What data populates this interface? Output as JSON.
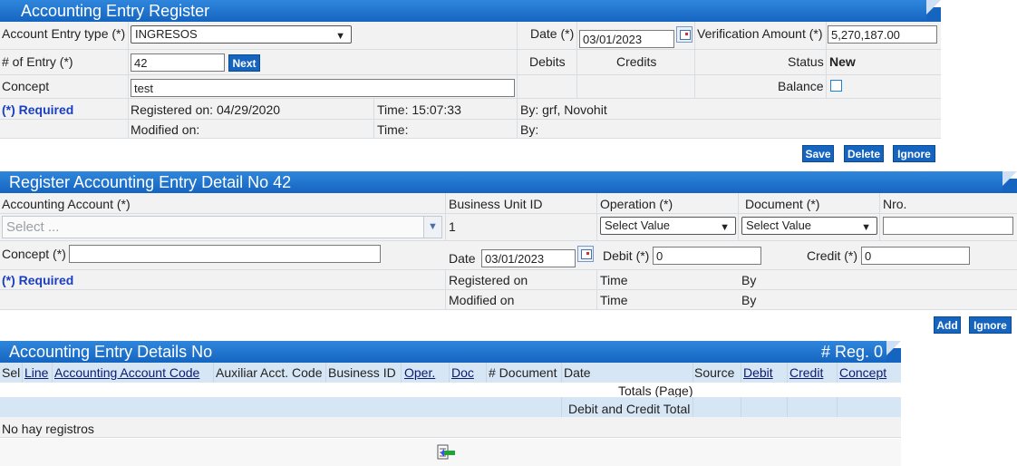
{
  "header": {
    "title": "Accounting Entry Register",
    "entry_type_label": "Account Entry type (*)",
    "entry_type_value": "INGRESOS",
    "date_label": "Date (*)",
    "date_value": "03/01/2023",
    "verification_label": "Verification Amount (*)",
    "verification_value": "5,270,187.00",
    "entry_no_label": "# of Entry (*)",
    "entry_no_value": "42",
    "next_label": "Next",
    "debits_label": "Debits",
    "credits_label": "Credits",
    "status_label": "Status",
    "status_value": "New",
    "concept_label": "Concept",
    "concept_value": "test",
    "balance_label": "Balance",
    "required_label": "(*) Required",
    "registered_on": "Registered on: 04/29/2020",
    "time_registered": "Time: 15:07:33",
    "by_registered": "By: grf, Novohit",
    "modified_on": "Modified on:",
    "time_modified": "Time:",
    "by_modified": "By:",
    "save_label": "Save",
    "delete_label": "Delete",
    "ignore_label": "Ignore"
  },
  "detail": {
    "title": "Register Accounting Entry Detail No 42",
    "account_label": "Accounting Account (*)",
    "account_placeholder": "Select ...",
    "business_unit_label": "Business Unit ID",
    "business_unit_value": "1",
    "operation_label": "Operation (*)",
    "operation_value": "Select Value",
    "document_label": "Document (*)",
    "document_value": "Select Value",
    "nro_label": "Nro.",
    "nro_value": "",
    "concept_label": "Concept (*)",
    "concept_value": "",
    "date_label": "Date",
    "date_value": "03/01/2023",
    "debit_label": "Debit (*)",
    "debit_value": "0",
    "credit_label": "Credit (*)",
    "credit_value": "0",
    "required_label": "(*) Required",
    "registered_on": "Registered on",
    "time_registered": "Time",
    "by_registered": "By",
    "modified_on": "Modified on",
    "time_modified": "Time",
    "by_modified": "By",
    "add_label": "Add",
    "ignore_label": "Ignore"
  },
  "list": {
    "title": "Accounting Entry Details No",
    "reg_count": "# Reg. 0",
    "columns": [
      "Sel",
      "Line",
      "Accounting Account Code",
      "Auxiliar Acct. Code",
      "Business ID",
      "Oper.",
      "Doc",
      "# Document",
      "Date",
      "Source",
      "Debit",
      "Credit",
      "Concept"
    ],
    "totals_page": "Totals (Page)",
    "debit_credit_total": "Debit and Credit Total",
    "empty_message": "No hay registros"
  },
  "colors": {
    "accent": "#1565c0",
    "required": "#1a3fbf",
    "row_bg": "#f2f2f2",
    "header_row_bg": "#d6e6f5"
  },
  "icons": [
    "calendar-icon",
    "chevron-down-icon",
    "export-icon"
  ]
}
